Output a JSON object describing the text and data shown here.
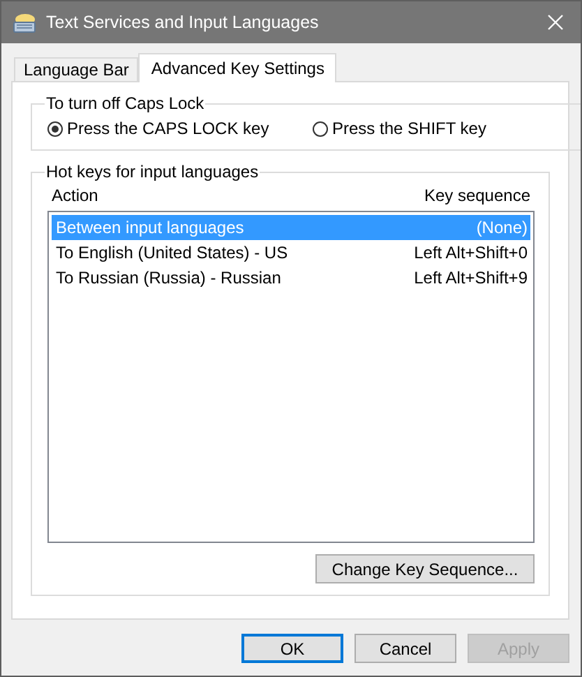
{
  "window": {
    "title": "Text Services and Input Languages"
  },
  "tabs": [
    {
      "label": "Language Bar",
      "selected": false
    },
    {
      "label": "Advanced Key Settings",
      "selected": true
    }
  ],
  "caps_lock": {
    "title": "To turn off Caps Lock",
    "options": [
      {
        "label": "Press the CAPS LOCK key",
        "selected": true
      },
      {
        "label": "Press the SHIFT key",
        "selected": false
      }
    ]
  },
  "hot_keys": {
    "title": "Hot keys for input languages",
    "columns": [
      "Action",
      "Key sequence"
    ],
    "rows": [
      {
        "action": "Between input languages",
        "key_sequence": "(None)",
        "selected": true
      },
      {
        "action": "To English (United States) - US",
        "key_sequence": "Left Alt+Shift+0",
        "selected": false
      },
      {
        "action": "To Russian (Russia) - Russian",
        "key_sequence": "Left Alt+Shift+9",
        "selected": false
      }
    ],
    "change_button": "Change Key Sequence..."
  },
  "buttons": [
    {
      "label": "OK",
      "default": true,
      "disabled": false
    },
    {
      "label": "Cancel",
      "default": false,
      "disabled": false
    },
    {
      "label": "Apply",
      "default": false,
      "disabled": true
    }
  ]
}
